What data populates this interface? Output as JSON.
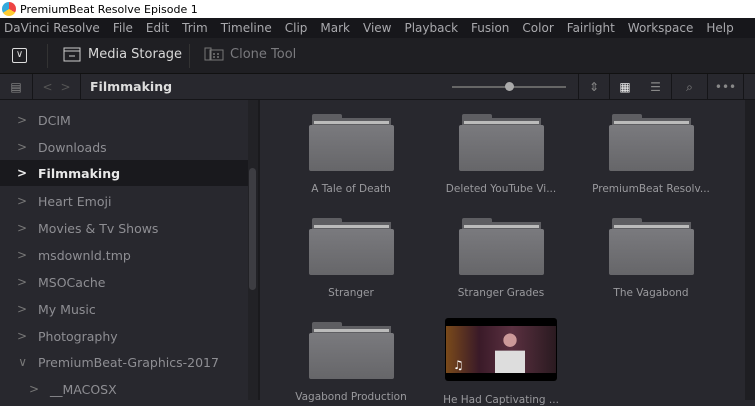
{
  "window": {
    "title": "PremiumBeat Resolve Episode 1"
  },
  "menu": [
    "DaVinci Resolve",
    "File",
    "Edit",
    "Trim",
    "Timeline",
    "Clip",
    "Mark",
    "View",
    "Playback",
    "Fusion",
    "Color",
    "Fairlight",
    "Workspace",
    "Help"
  ],
  "toolbar": {
    "media_storage": "Media Storage",
    "clone_tool": "Clone Tool"
  },
  "path": {
    "current": "Filmmaking",
    "zoom_slider": 0.47
  },
  "sidebar": {
    "items": [
      {
        "label": "DCIM",
        "expanded": false
      },
      {
        "label": "Downloads",
        "expanded": false
      },
      {
        "label": "Filmmaking",
        "expanded": false,
        "selected": true
      },
      {
        "label": "Heart Emoji",
        "expanded": false
      },
      {
        "label": "Movies & Tv Shows",
        "expanded": false
      },
      {
        "label": "msdownld.tmp",
        "expanded": false
      },
      {
        "label": "MSOCache",
        "expanded": false
      },
      {
        "label": "My Music",
        "expanded": false
      },
      {
        "label": "Photography",
        "expanded": false
      },
      {
        "label": "PremiumBeat-Graphics-2017",
        "expanded": true
      },
      {
        "label": "__MACOSX",
        "expanded": false,
        "child": true
      }
    ]
  },
  "grid": {
    "items": [
      {
        "label": "A Tale of Death",
        "type": "folder"
      },
      {
        "label": "Deleted YouTube Vi...",
        "type": "folder"
      },
      {
        "label": "PremiumBeat Resolv...",
        "type": "folder"
      },
      {
        "label": "Stranger",
        "type": "folder"
      },
      {
        "label": "Stranger Grades",
        "type": "folder"
      },
      {
        "label": "The Vagabond",
        "type": "folder"
      },
      {
        "label": "Vagabond Production",
        "type": "folder"
      },
      {
        "label": "He Had Captivating ...",
        "type": "clip"
      }
    ]
  }
}
